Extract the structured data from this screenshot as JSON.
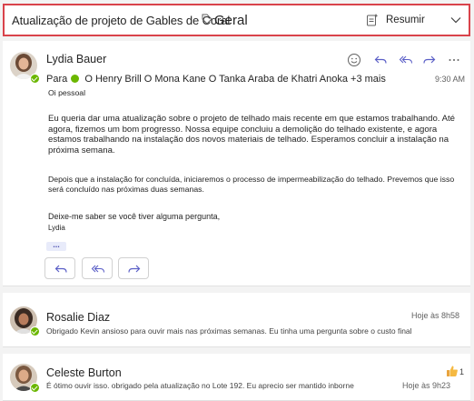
{
  "header": {
    "subject": "Atualização de projeto de Gables de Coral",
    "tag": "Geral",
    "summarize_label": "Resumir"
  },
  "messages": [
    {
      "sender": "Lydia Bauer",
      "to_label": "Para",
      "recipients": "O Henry Brill O Mona Kane O Tanka Araba de Khatri Anoka +3 mais",
      "time": "9:30 AM",
      "body": [
        "Oi pessoal",
        "Eu queria dar uma atualização sobre o projeto de telhado mais recente em que estamos trabalhando. Até agora, fizemos um bom progresso. Nossa equipe concluiu a demolição do telhado existente, e agora estamos trabalhando na instalação dos novos materiais de telhado. Esperamos concluir a instalação na próxima semana.",
        "Depois que a instalação for concluída, iniciaremos o processo de impermeabilização do telhado. Prevemos que isso será concluído nas próximas duas semanas.",
        "Deixe-me saber se você tiver alguma pergunta,",
        "Lydia"
      ],
      "ellipsis": "...",
      "avatar_color": "#c98b6a"
    },
    {
      "sender": "Rosalie Diaz",
      "time": "Hoje às 8h58",
      "preview": "Obrigado Kevin ansioso para ouvir mais nas próximas semanas. Eu tinha uma pergunta sobre o custo final",
      "avatar_color": "#8a5a44"
    },
    {
      "sender": "Celeste Burton",
      "time": "Hoje às 9h23",
      "preview": "É ótimo ouvir isso. obrigado pela atualização no Lote 192. Eu aprecio ser mantido inborne",
      "reaction_count": "1",
      "avatar_color": "#9c6b4e"
    }
  ],
  "colors": {
    "accent": "#5b5fc7",
    "highlight_border": "#d9434b",
    "presence": "#6bb700"
  }
}
